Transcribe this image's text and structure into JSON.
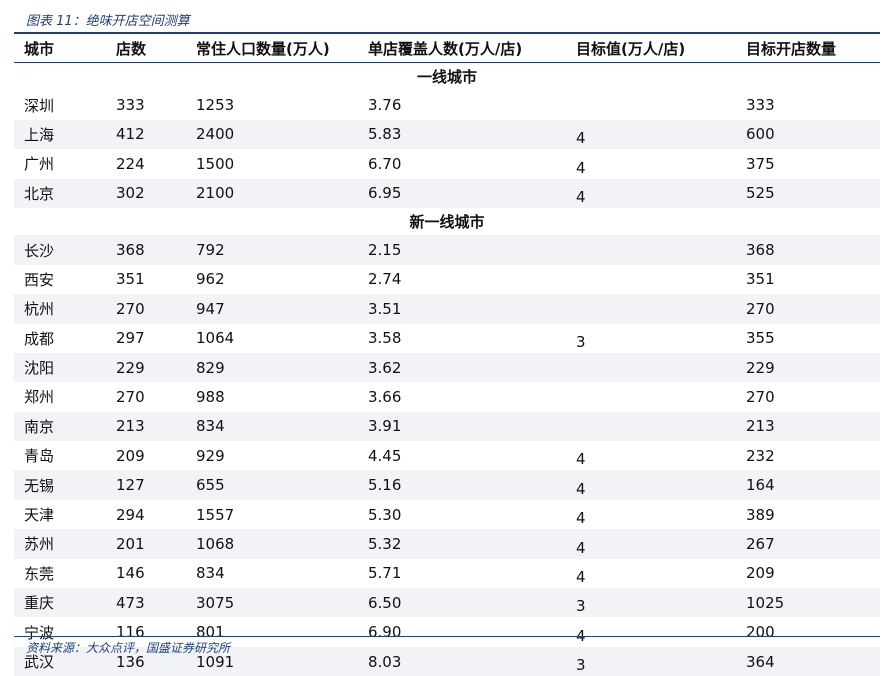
{
  "caption": "图表 11：绝味开店空间测算",
  "headers": [
    "城市",
    "店数",
    "常住人口数量(万人)",
    "单店覆盖人数(万人/店)",
    "目标值(万人/店)",
    "目标开店数量"
  ],
  "sections": [
    {
      "title": "一线城市",
      "rows": [
        [
          "深圳",
          "333",
          "1253",
          "3.76",
          "",
          "333"
        ],
        [
          "上海",
          "412",
          "2400",
          "5.83",
          "4",
          "600"
        ],
        [
          "广州",
          "224",
          "1500",
          "6.70",
          "4",
          "375"
        ],
        [
          "北京",
          "302",
          "2100",
          "6.95",
          "4",
          "525"
        ]
      ]
    },
    {
      "title": "新一线城市",
      "rows": [
        [
          "长沙",
          "368",
          "792",
          "2.15",
          "",
          "368"
        ],
        [
          "西安",
          "351",
          "962",
          "2.74",
          "",
          "351"
        ],
        [
          "杭州",
          "270",
          "947",
          "3.51",
          "",
          "270"
        ],
        [
          "成都",
          "297",
          "1064",
          "3.58",
          "3",
          "355"
        ],
        [
          "沈阳",
          "229",
          "829",
          "3.62",
          "",
          "229"
        ],
        [
          "郑州",
          "270",
          "988",
          "3.66",
          "",
          "270"
        ],
        [
          "南京",
          "213",
          "834",
          "3.91",
          "",
          "213"
        ],
        [
          "青岛",
          "209",
          "929",
          "4.45",
          "4",
          "232"
        ],
        [
          "无锡",
          "127",
          "655",
          "5.16",
          "4",
          "164"
        ],
        [
          "天津",
          "294",
          "1557",
          "5.30",
          "4",
          "389"
        ],
        [
          "苏州",
          "201",
          "1068",
          "5.32",
          "4",
          "267"
        ],
        [
          "东莞",
          "146",
          "834",
          "5.71",
          "4",
          "209"
        ],
        [
          "重庆",
          "473",
          "3075",
          "6.50",
          "3",
          "1025"
        ],
        [
          "宁波",
          "116",
          "801",
          "6.90",
          "4",
          "200"
        ],
        [
          "武汉",
          "136",
          "1091",
          "8.03",
          "3",
          "364"
        ]
      ]
    }
  ],
  "source": "资料来源：大众点评，国盛证券研究所",
  "colors": {
    "accent": "#1f3f7a",
    "row_shade": "#f1f3f7"
  }
}
